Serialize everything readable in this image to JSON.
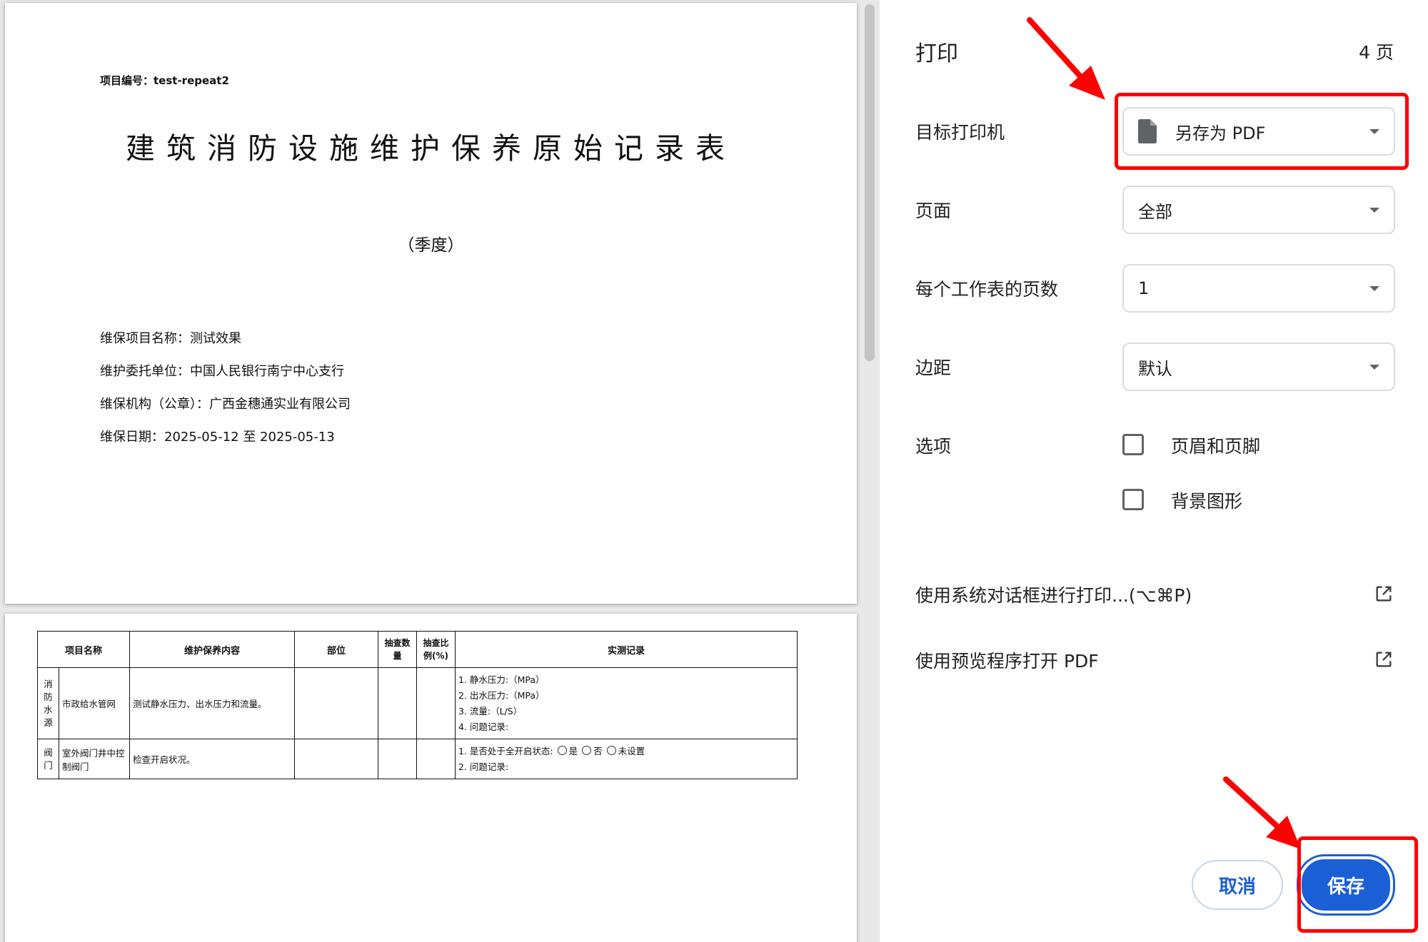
{
  "document": {
    "page1": {
      "project_no": "项目编号：test-repeat2",
      "title": "建筑消防设施维护保养原始记录表",
      "subtitle": "（季度）",
      "info": [
        "维保项目名称：测试效果",
        "维护委托单位：中国人民银行南宁中心支行",
        "维保机构（公章）：广西金穗通实业有限公司",
        "维保日期：2025-05-12 至 2025-05-13"
      ]
    },
    "page2": {
      "headers": [
        "项目名称",
        "维护保养内容",
        "部位",
        "抽查数量",
        "抽查比例(%)",
        "实测记录"
      ],
      "rows": [
        {
          "category": [
            "消",
            "防",
            "水",
            "源"
          ],
          "item": "市政给水管网",
          "content": "测试静水压力、出水压力和流量。",
          "records": [
            "1. 静水压力:（MPa）",
            "2. 出水压力:（MPa）",
            "3. 流量:（L/S）",
            "4. 问题记录:"
          ]
        },
        {
          "category": [
            "阀",
            "门"
          ],
          "item": "室外阀门井中控制阀门",
          "content": "检查开启状况。",
          "record_question": "1. 是否处于全开启状态:",
          "options": [
            "是",
            "否",
            "未设置"
          ],
          "record_issue": "2. 问题记录:"
        }
      ]
    }
  },
  "panel": {
    "title": "打印",
    "page_count": "4 页",
    "destination_label": "目标打印机",
    "destination_value": "另存为 PDF",
    "pages_label": "页面",
    "pages_value": "全部",
    "pages_per_sheet_label": "每个工作表的页数",
    "pages_per_sheet_value": "1",
    "margins_label": "边距",
    "margins_value": "默认",
    "options_label": "选项",
    "option_headers_footers": "页眉和页脚",
    "option_background": "背景图形",
    "system_dialog_link": "使用系统对话框进行打印...(⌥⌘P)",
    "open_preview_link": "使用预览程序打开 PDF",
    "cancel_label": "取消",
    "save_label": "保存"
  },
  "colors": {
    "primary": "#1b5fd6",
    "annotation": "#ff0000",
    "preview_background": "#e8e8e8"
  },
  "icons": [
    "document-icon",
    "dropdown-caret-icon",
    "external-link-icon",
    "annotation-arrow-icon"
  ]
}
